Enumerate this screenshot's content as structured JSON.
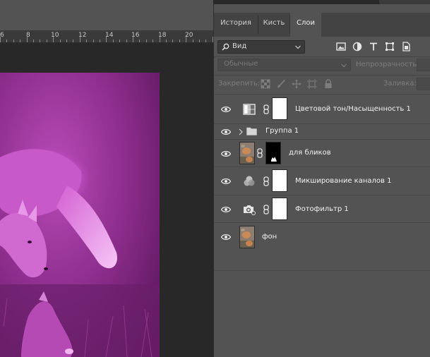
{
  "ruler": {
    "labels": [
      "6",
      "8",
      "10",
      "12",
      "14",
      "16",
      "18",
      "20"
    ]
  },
  "panel": {
    "tabs": [
      {
        "label": "История",
        "active": false
      },
      {
        "label": "Кисть",
        "active": false
      },
      {
        "label": "Слои",
        "active": true
      }
    ],
    "filter": {
      "kind_label": "Вид",
      "icons": [
        "image-filter-icon",
        "adjustment-filter-icon",
        "type-filter-icon",
        "shape-filter-icon",
        "smart-object-filter-icon"
      ]
    },
    "blend": {
      "mode_label": "Обычные",
      "opacity_label": "Непрозрачность:",
      "lock_label": "Закрепить:",
      "fill_label": "Заливка:"
    },
    "layers": [
      {
        "name": "Цветовой тон/Насыщенность 1",
        "kind": "adjustment",
        "icon": "hue-saturation-icon",
        "mask": "white"
      },
      {
        "name": "Группа 1",
        "kind": "group",
        "icon": "folder-icon",
        "mask": "none"
      },
      {
        "name": "для бликов",
        "kind": "pixel",
        "icon": "photo-thumbnail",
        "mask": "black"
      },
      {
        "name": "Микширование каналов 1",
        "kind": "adjustment",
        "icon": "channel-mixer-icon",
        "mask": "white"
      },
      {
        "name": "Фотофильтр 1",
        "kind": "adjustment",
        "icon": "photo-filter-icon",
        "mask": "white"
      },
      {
        "name": "фон",
        "kind": "pixel",
        "icon": "photo-thumbnail",
        "mask": "none"
      }
    ]
  },
  "colors": {
    "panel_bg": "#535353",
    "tabbar_bg": "#434343",
    "canvas_tint": "#c040c0"
  }
}
